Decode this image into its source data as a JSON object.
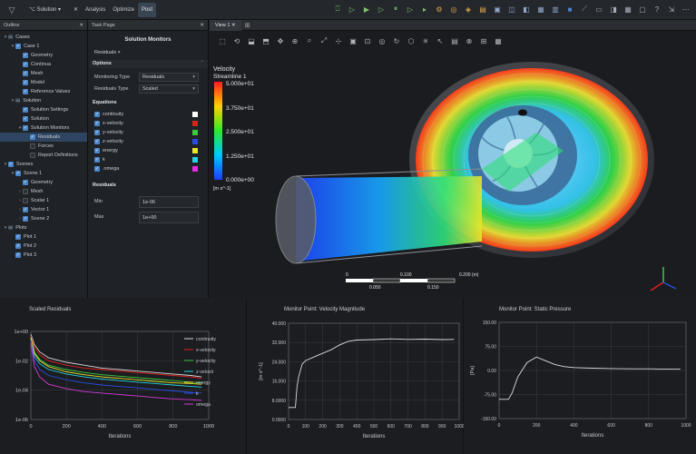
{
  "menubar": {
    "solution_label": "Solution",
    "items": [
      "Analysis",
      "Optimize",
      "Post"
    ],
    "active": "Post"
  },
  "outline": {
    "title": "Outline",
    "rows": [
      {
        "label": "Cases",
        "indent": 0,
        "arrow": "▾",
        "cb": "none",
        "icon": "folder"
      },
      {
        "label": "Case 1",
        "indent": 1,
        "arrow": "▾",
        "cb": "on"
      },
      {
        "label": "Geometry",
        "indent": 2,
        "arrow": "",
        "cb": "on"
      },
      {
        "label": "Continua",
        "indent": 2,
        "arrow": "",
        "cb": "on"
      },
      {
        "label": "Mesh",
        "indent": 2,
        "arrow": "",
        "cb": "on"
      },
      {
        "label": "Model",
        "indent": 2,
        "arrow": "",
        "cb": "on"
      },
      {
        "label": "Reference Values",
        "indent": 2,
        "arrow": "",
        "cb": "on"
      },
      {
        "label": "Solution",
        "indent": 1,
        "arrow": "▾",
        "cb": "none",
        "icon": "folder"
      },
      {
        "label": "Solution Settings",
        "indent": 2,
        "arrow": "",
        "cb": "on"
      },
      {
        "label": "Solution",
        "indent": 2,
        "arrow": "",
        "cb": "on"
      },
      {
        "label": "Solution Monitors",
        "indent": 2,
        "arrow": "▾",
        "cb": "on"
      },
      {
        "label": "Residuals",
        "indent": 3,
        "arrow": "",
        "cb": "on",
        "selected": true
      },
      {
        "label": "Forces",
        "indent": 3,
        "arrow": "",
        "cb": "off"
      },
      {
        "label": "Report Definitions",
        "indent": 3,
        "arrow": "",
        "cb": "off"
      },
      {
        "label": "Scenes",
        "indent": 0,
        "arrow": "▾",
        "cb": "on"
      },
      {
        "label": "Scene 1",
        "indent": 1,
        "arrow": "▾",
        "cb": "on"
      },
      {
        "label": "Geometry",
        "indent": 2,
        "arrow": "",
        "cb": "on"
      },
      {
        "label": "Mesh",
        "indent": 2,
        "arrow": "›",
        "cb": "off"
      },
      {
        "label": "Scalar 1",
        "indent": 2,
        "arrow": "›",
        "cb": "off"
      },
      {
        "label": "Vector 1",
        "indent": 2,
        "arrow": "›",
        "cb": "on"
      },
      {
        "label": "Scene 2",
        "indent": 2,
        "arrow": "›",
        "cb": "on"
      },
      {
        "label": "Plots",
        "indent": 0,
        "arrow": "▾",
        "cb": "none",
        "icon": "folder"
      },
      {
        "label": "Plot 1",
        "indent": 1,
        "arrow": "",
        "cb": "on"
      },
      {
        "label": "Plot 2",
        "indent": 1,
        "arrow": "",
        "cb": "on"
      },
      {
        "label": "Plot 3",
        "indent": 1,
        "arrow": "",
        "cb": "on"
      }
    ]
  },
  "taskpage": {
    "title": "Task Page",
    "heading": "Solution Monitors",
    "selector": "Residuals",
    "options_label": "Options",
    "monitoring_type_label": "Monitoring Type",
    "monitoring_type_value": "Residuals",
    "residuals_type_label": "Residuals Type",
    "residuals_type_value": "Scaled",
    "equations_label": "Equations",
    "equations": [
      {
        "name": "continuity",
        "color": "#ffffff"
      },
      {
        "name": "x-velocity",
        "color": "#e0201c"
      },
      {
        "name": "y-velocity",
        "color": "#3cc83c"
      },
      {
        "name": "z-velocity",
        "color": "#2a4de0"
      },
      {
        "name": "energy",
        "color": "#e6e62a"
      },
      {
        "name": "k",
        "color": "#27d3e0"
      },
      {
        "name": ".omega",
        "color": "#e62ae0"
      }
    ],
    "residuals_label": "Residuals",
    "min_label": "Min",
    "min_value": "1e-06",
    "max_label": "Max",
    "max_value": "1e+00"
  },
  "viewport": {
    "tab": "View 1",
    "legend_title": "Velocity",
    "legend_subtitle": "Streamline 1",
    "legend_ticks": [
      "5.000e+01",
      "3.750e+01",
      "2.500e+01",
      "1.250e+01",
      "0.000e+00"
    ],
    "legend_unit": "[m s^-1]",
    "scale_top": [
      "0",
      "0.100",
      "0.200 (m)"
    ],
    "scale_bottom": [
      "0.050",
      "0.150"
    ]
  },
  "plots": {
    "residuals": {
      "title": "Scaled Residuals",
      "xlabel": "Iterations",
      "legend": [
        "continuity",
        "x-velocity",
        "y-velocity",
        "z-velocit",
        "energy",
        "k",
        "omega"
      ]
    },
    "velocity": {
      "title": "Monitor Point: Velocity Magnitude",
      "xlabel": "Iterations",
      "ylabel": "[m s^-1]"
    },
    "pressure": {
      "title": "Monitor Point: Static Pressure",
      "xlabel": "Iterations",
      "ylabel": "[Pa]"
    }
  },
  "chart_data": [
    {
      "type": "line",
      "title": "Scaled Residuals",
      "xlabel": "Iterations",
      "ylabel": "",
      "xlim": [
        0,
        1000
      ],
      "ylim_log10": [
        -6,
        0
      ],
      "x_ticks": [
        "0",
        "200",
        "400",
        "600",
        "800",
        "1000"
      ],
      "y_ticks": [
        "1e+00",
        "1e-02",
        "1e-04",
        "1e-06"
      ],
      "x": [
        0,
        20,
        50,
        100,
        200,
        300,
        400,
        500,
        600,
        700,
        800,
        900,
        960
      ],
      "series": [
        {
          "name": "continuity",
          "color": "#d8d8d8",
          "log10": [
            -0.2,
            -0.9,
            -1.4,
            -1.8,
            -2.1,
            -2.3,
            -2.5,
            -2.6,
            -2.7,
            -2.8,
            -2.9,
            -3.0,
            -3.1
          ]
        },
        {
          "name": "x-velocity",
          "color": "#e0201c",
          "log10": [
            -0.3,
            -1.1,
            -1.6,
            -2.0,
            -2.3,
            -2.5,
            -2.6,
            -2.7,
            -2.8,
            -2.9,
            -3.0,
            -3.1,
            -3.2
          ]
        },
        {
          "name": "y-velocity",
          "color": "#3cc83c",
          "log10": [
            -0.4,
            -1.4,
            -1.9,
            -2.3,
            -2.6,
            -2.8,
            -2.95,
            -3.05,
            -3.15,
            -3.25,
            -3.35,
            -3.45,
            -3.5
          ]
        },
        {
          "name": "z-velocit",
          "color": "#27d3e0",
          "log10": [
            -0.5,
            -1.7,
            -2.2,
            -2.6,
            -2.9,
            -3.1,
            -3.25,
            -3.35,
            -3.45,
            -3.55,
            -3.65,
            -3.75,
            -3.8
          ]
        },
        {
          "name": "energy",
          "color": "#e6e62a",
          "log10": [
            -0.4,
            -1.5,
            -2.0,
            -2.4,
            -2.75,
            -2.95,
            -3.1,
            -3.2,
            -3.3,
            -3.4,
            -3.5,
            -3.55,
            -3.6
          ]
        },
        {
          "name": "k",
          "color": "#2a4de0",
          "log10": [
            -0.6,
            -2.0,
            -2.6,
            -3.0,
            -3.3,
            -3.5,
            -3.65,
            -3.75,
            -3.85,
            -3.95,
            -4.05,
            -4.15,
            -4.2
          ]
        },
        {
          "name": "omega",
          "color": "#d43ad4",
          "log10": [
            -0.8,
            -2.4,
            -3.1,
            -3.6,
            -3.9,
            -4.1,
            -4.2,
            -4.3,
            -4.4,
            -4.5,
            -4.6,
            -4.65,
            -4.7
          ]
        }
      ]
    },
    {
      "type": "line",
      "title": "Monitor Point: Velocity Magnitude",
      "xlabel": "Iterations",
      "ylabel": "[m s^-1]",
      "xlim": [
        0,
        1000
      ],
      "ylim": [
        0,
        40
      ],
      "x_ticks": [
        "0",
        "100",
        "200",
        "300",
        "400",
        "500",
        "600",
        "700",
        "800",
        "900",
        "1000"
      ],
      "y_ticks": [
        "0.0000",
        "8.0000",
        "16.000",
        "24.000",
        "32.000",
        "40.000"
      ],
      "x": [
        0,
        40,
        50,
        60,
        80,
        100,
        150,
        200,
        250,
        300,
        350,
        400,
        500,
        600,
        700,
        800,
        900,
        970
      ],
      "y": [
        5.0,
        5.0,
        14.0,
        18.0,
        23.0,
        24.5,
        26.0,
        27.5,
        29.0,
        31.0,
        32.5,
        33.0,
        33.2,
        33.5,
        33.3,
        33.4,
        33.2,
        33.3
      ]
    },
    {
      "type": "line",
      "title": "Monitor Point: Static Pressure",
      "xlabel": "Iterations",
      "ylabel": "[Pa]",
      "xlim": [
        0,
        1000
      ],
      "ylim": [
        -150,
        150
      ],
      "x_ticks": [
        "0",
        "200",
        "400",
        "600",
        "800",
        "1000"
      ],
      "y_ticks": [
        "-150.00",
        "-75.00",
        "0.00",
        "75.00",
        "150.00"
      ],
      "x": [
        0,
        50,
        70,
        100,
        150,
        200,
        250,
        300,
        350,
        400,
        500,
        600,
        700,
        800,
        900,
        970
      ],
      "y": [
        -90,
        -90,
        -70,
        -20,
        25,
        42,
        30,
        18,
        12,
        9,
        7,
        6,
        5,
        5,
        4,
        4
      ]
    }
  ]
}
